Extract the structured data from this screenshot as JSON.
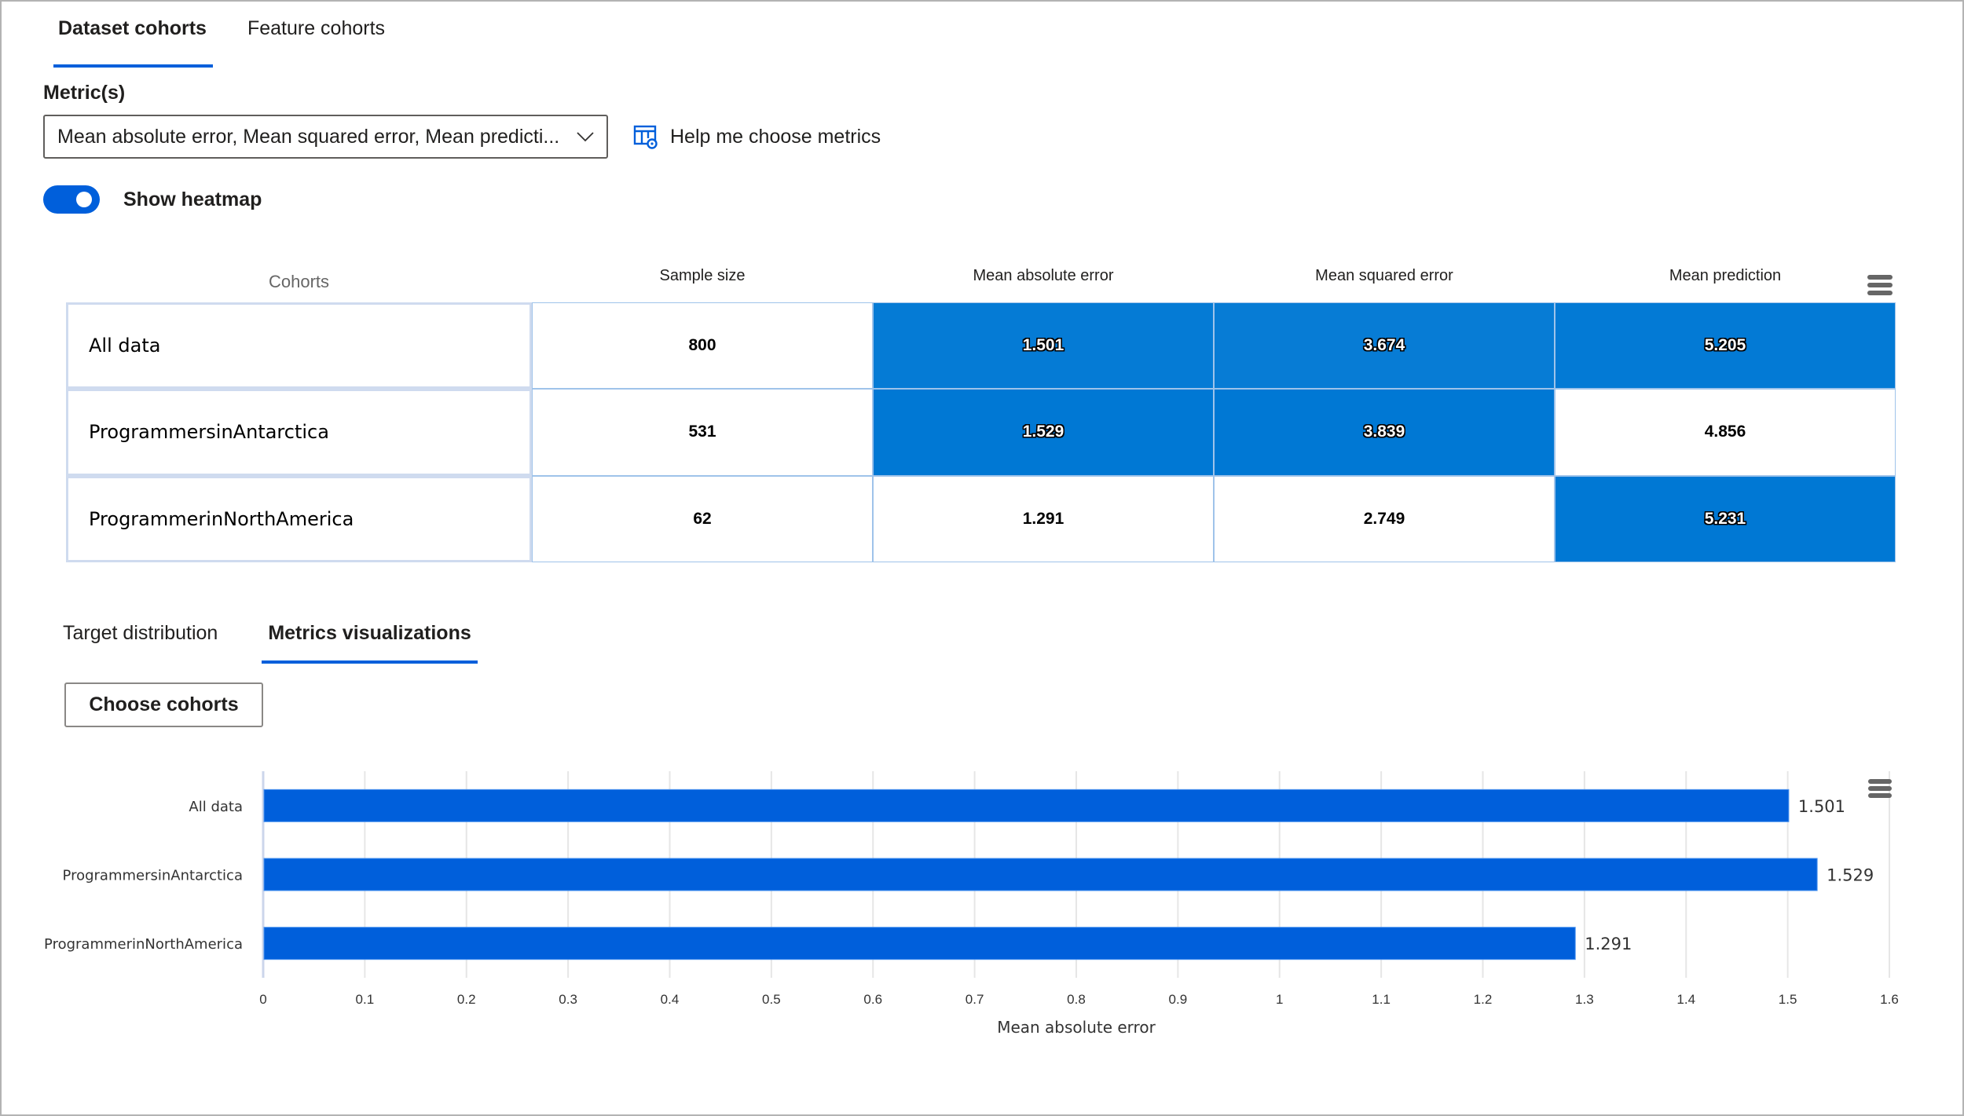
{
  "top_tabs": [
    {
      "label": "Dataset cohorts",
      "active": true
    },
    {
      "label": "Feature cohorts",
      "active": false
    }
  ],
  "metrics": {
    "label": "Metric(s)",
    "selected_value": "Mean absolute error, Mean squared error, Mean predicti...",
    "help_link": "Help me choose metrics"
  },
  "heatmap_toggle": {
    "label": "Show heatmap",
    "on": true
  },
  "heatmap": {
    "columns": [
      "Cohorts",
      "Sample size",
      "Mean absolute error",
      "Mean squared error",
      "Mean prediction"
    ],
    "rows": [
      {
        "cohort": "All data",
        "sample_size": "800",
        "mae": "1.501",
        "mse": "3.674",
        "mean_prediction": "5.205"
      },
      {
        "cohort": "ProgrammersinAntarctica",
        "sample_size": "531",
        "mae": "1.529",
        "mse": "3.839",
        "mean_prediction": "4.856"
      },
      {
        "cohort": "ProgrammerinNorthAmerica",
        "sample_size": "62",
        "mae": "1.291",
        "mse": "2.749",
        "mean_prediction": "5.231"
      }
    ],
    "colors": {
      "max": "#0078d4",
      "min": "#ffffff"
    }
  },
  "lower_tabs": [
    {
      "label": "Target distribution",
      "active": false
    },
    {
      "label": "Metrics visualizations",
      "active": true
    }
  ],
  "choose_cohorts_label": "Choose cohorts",
  "chart_data": {
    "type": "bar",
    "orientation": "horizontal",
    "categories": [
      "All data",
      "ProgrammersinAntarctica",
      "ProgrammerinNorthAmerica"
    ],
    "values": [
      1.501,
      1.529,
      1.291
    ],
    "data_labels": [
      "1.501",
      "1.529",
      "1.291"
    ],
    "title": "",
    "xlabel": "Mean absolute error",
    "ylabel": "",
    "xlim": [
      0,
      1.6
    ],
    "x_ticks": [
      "0",
      "0.1",
      "0.2",
      "0.3",
      "0.4",
      "0.5",
      "0.6",
      "0.7",
      "0.8",
      "0.9",
      "1",
      "1.1",
      "1.2",
      "1.3",
      "1.4",
      "1.5",
      "1.6"
    ],
    "grid": true,
    "bar_color": "#005fdb"
  }
}
